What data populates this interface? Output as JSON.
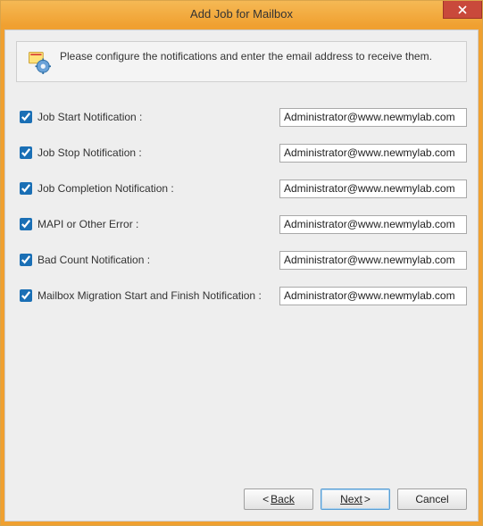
{
  "title": "Add Job for Mailbox",
  "info": "Please configure the notifications and enter the email address to receive them.",
  "rows": [
    {
      "label": "Job Start Notification :",
      "value": "Administrator@www.newmylab.com",
      "checked": true
    },
    {
      "label": "Job Stop Notification :",
      "value": "Administrator@www.newmylab.com",
      "checked": true
    },
    {
      "label": "Job Completion Notification :",
      "value": "Administrator@www.newmylab.com",
      "checked": true
    },
    {
      "label": "MAPI or Other Error :",
      "value": "Administrator@www.newmylab.com",
      "checked": true
    },
    {
      "label": "Bad Count Notification :",
      "value": "Administrator@www.newmylab.com",
      "checked": true
    },
    {
      "label": "Mailbox Migration Start and Finish Notification :",
      "value": "Administrator@www.newmylab.com",
      "checked": true
    }
  ],
  "buttons": {
    "back": "Back",
    "next": "Next",
    "cancel": "Cancel"
  }
}
